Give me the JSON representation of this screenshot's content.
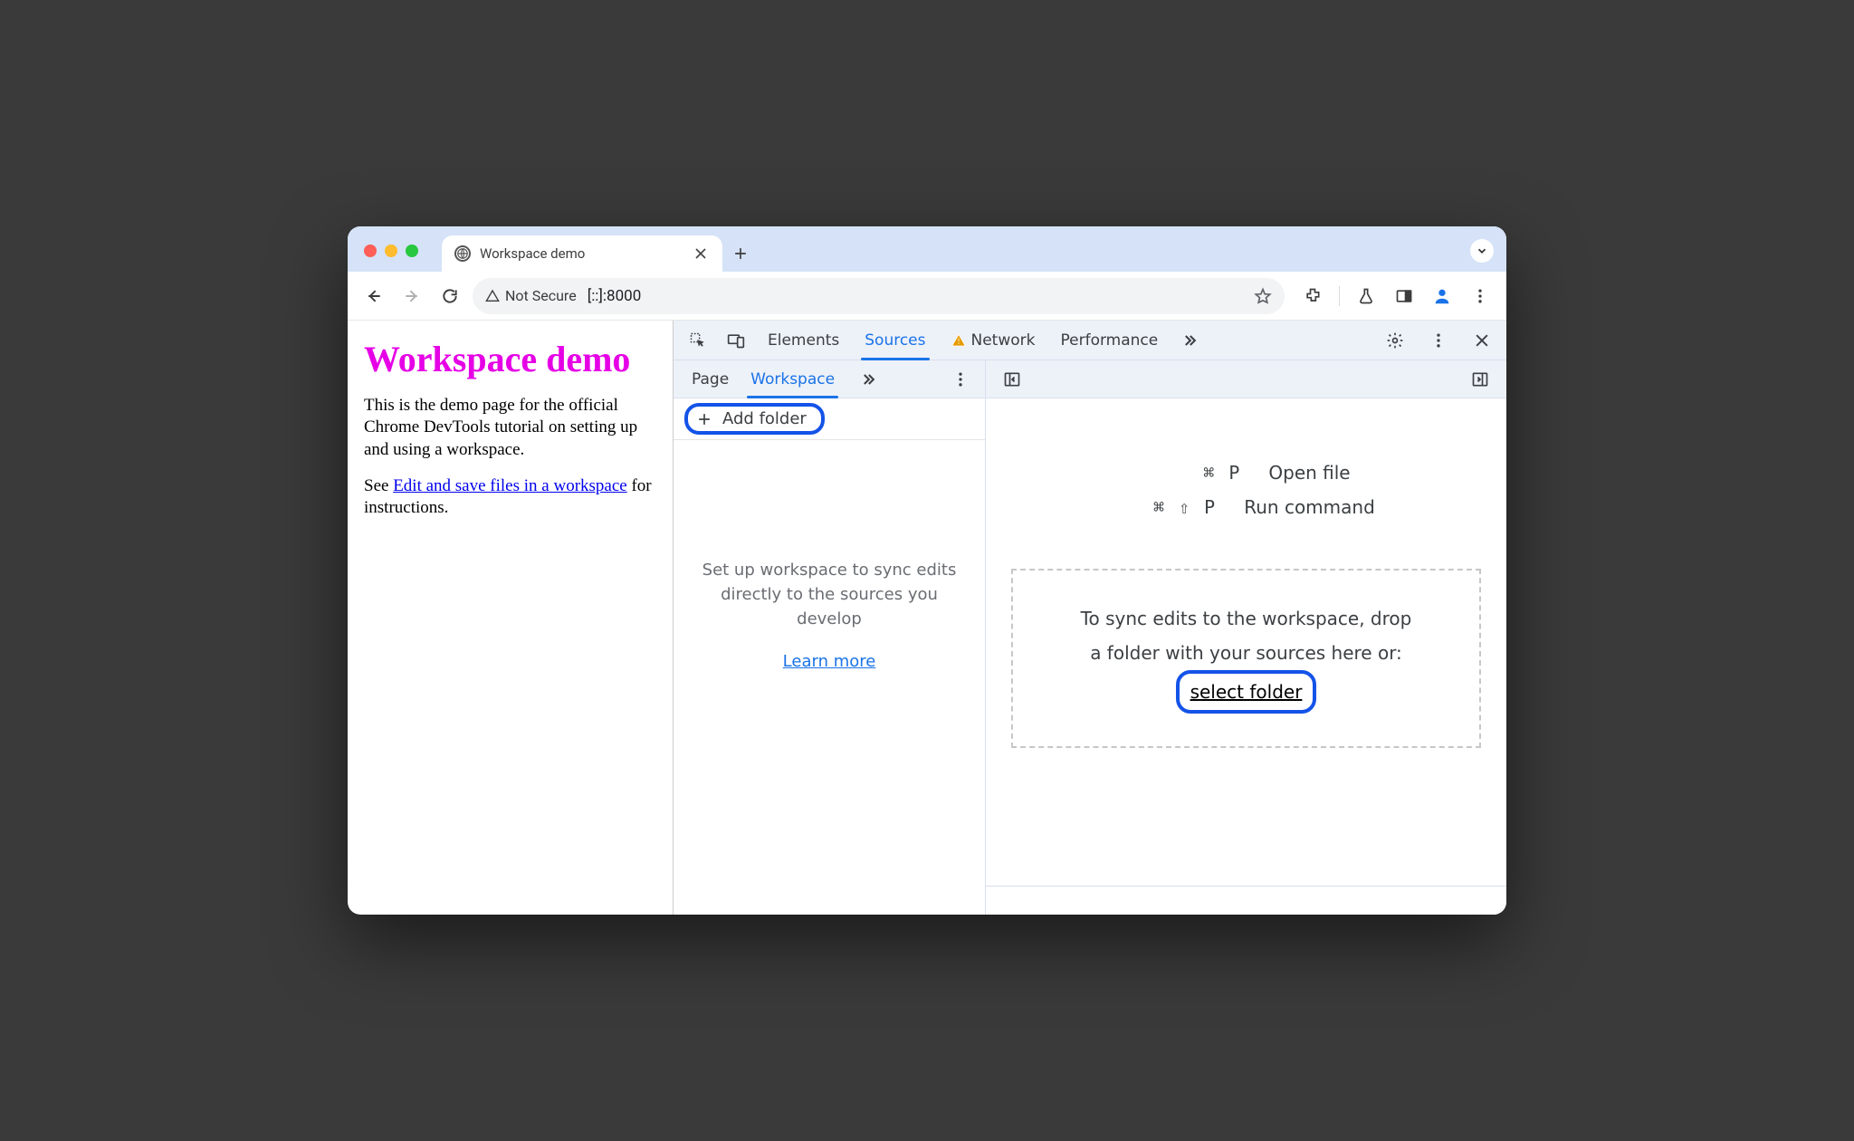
{
  "tabs": {
    "title": "Workspace demo"
  },
  "omnibox": {
    "not_secure": "Not Secure",
    "url": "[::]:8000"
  },
  "page": {
    "heading": "Workspace demo",
    "p1": "This is the demo page for the official Chrome DevTools tutorial on setting up and using a workspace.",
    "p2_prefix": "See ",
    "p2_link": "Edit and save files in a workspace",
    "p2_suffix": " for instructions."
  },
  "devtools": {
    "tabs": {
      "elements": "Elements",
      "sources": "Sources",
      "network": "Network",
      "performance": "Performance"
    },
    "subtabs": {
      "page": "Page",
      "workspace": "Workspace"
    },
    "add_folder": "Add folder",
    "workspace_hint": "Set up workspace to sync edits directly to the sources you develop",
    "learn_more": "Learn more",
    "shortcut1": {
      "keys": "⌘ P",
      "label": "Open file"
    },
    "shortcut2": {
      "keys": "⌘ ⇧ P",
      "label": "Run command"
    },
    "dropzone_line1": "To sync edits to the workspace, drop",
    "dropzone_line2": "a folder with your sources here or:",
    "select_folder": "select folder"
  }
}
